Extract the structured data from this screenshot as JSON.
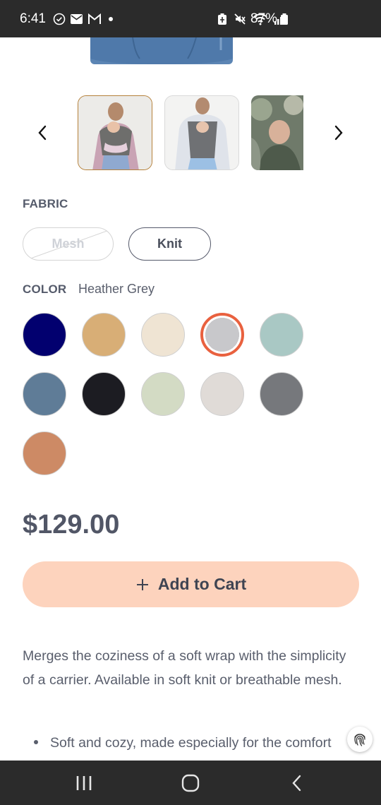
{
  "status_bar": {
    "time": "6:41",
    "battery_percent": "87%",
    "left_icons": [
      "check-circle-icon",
      "mail-icon",
      "gmail-icon",
      "dot-icon"
    ],
    "right_icons": [
      "battery-saver-icon",
      "mute-icon",
      "wifi-icon",
      "signal-icon",
      "battery-icon"
    ]
  },
  "gallery": {
    "prev_label": "‹",
    "next_label": "›",
    "thumbnails": [
      {
        "name": "Carrier front view, mother with baby",
        "selected": true
      },
      {
        "name": "Carrier worn by father",
        "selected": false
      },
      {
        "name": "Baby in carrier outdoors",
        "selected": false
      }
    ]
  },
  "fabric": {
    "heading": "FABRIC",
    "options": [
      {
        "label": "Mesh",
        "available": false,
        "selected": false
      },
      {
        "label": "Knit",
        "available": true,
        "selected": true
      }
    ]
  },
  "color": {
    "heading": "COLOR",
    "selected_name": "Heather Grey",
    "swatches": [
      {
        "hex": "#02006f",
        "selected": false
      },
      {
        "hex": "#d8ae76",
        "selected": false
      },
      {
        "hex": "#efe4d3",
        "selected": false
      },
      {
        "hex": "#c8c8cb",
        "selected": true
      },
      {
        "hex": "#a9c8c4",
        "selected": false
      },
      {
        "hex": "#5f7c97",
        "selected": false
      },
      {
        "hex": "#1c1c22",
        "selected": false
      },
      {
        "hex": "#d3dbc4",
        "selected": false
      },
      {
        "hex": "#e0dbd7",
        "selected": false
      },
      {
        "hex": "#76787c",
        "selected": false
      },
      {
        "hex": "#cd8a65",
        "selected": false
      }
    ]
  },
  "price": "$129.00",
  "add_to_cart": {
    "icon": "plus-icon",
    "label": "Add to Cart"
  },
  "description": "Merges the coziness of a soft wrap with the simplicity of a carrier. Available in soft knit or breathable mesh.",
  "bullets": [
    "Soft and cozy, made especially for the comfort"
  ],
  "nav_bar": {
    "buttons": [
      "recents-icon",
      "home-icon",
      "back-icon"
    ]
  },
  "colors": {
    "accent_selected": "#e9613f",
    "cart_button_bg": "#fdd3bd",
    "thumb_selected_border": "#b5813b"
  }
}
